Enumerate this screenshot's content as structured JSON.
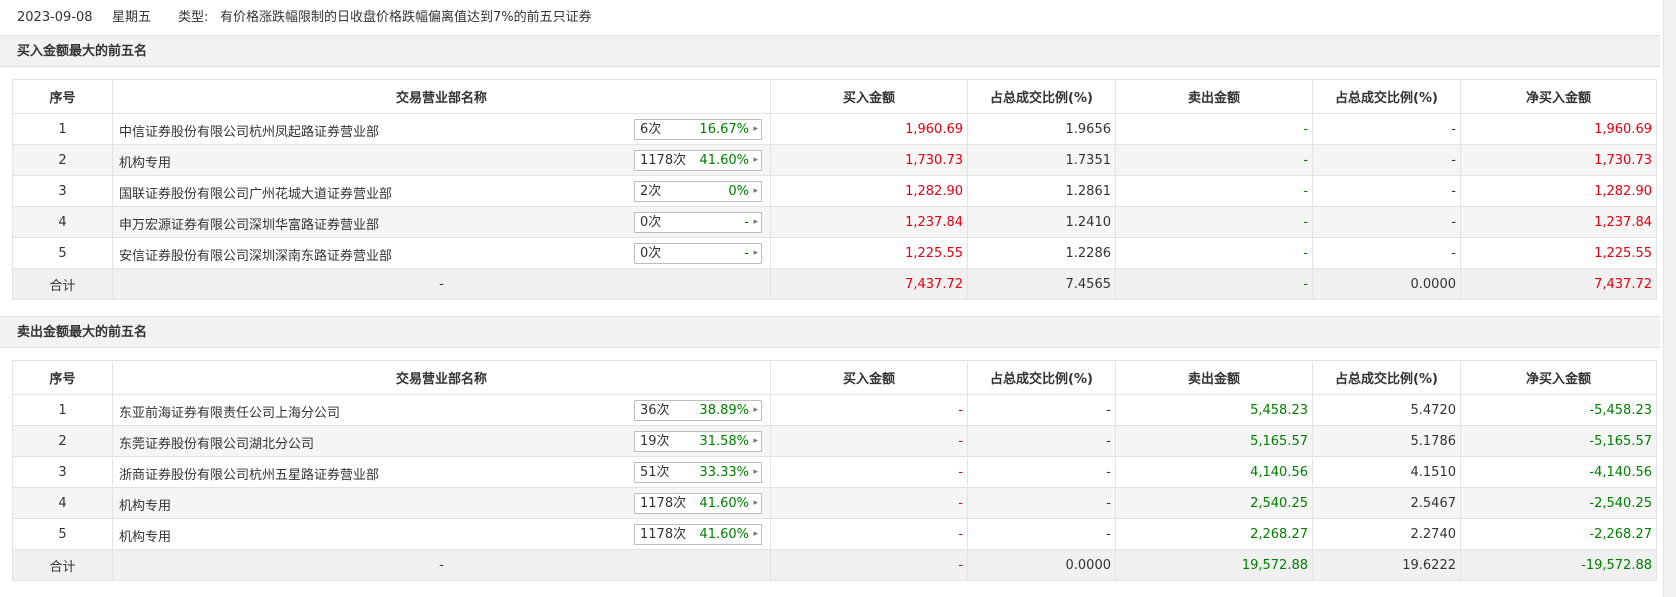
{
  "header": {
    "date": "2023-09-08",
    "weekday": "星期五",
    "type_label": "类型:",
    "type_value": "有价格涨跌幅限制的日收盘价格跌幅偏离值达到7%的前五只证券"
  },
  "columns": [
    "序号",
    "交易营业部名称",
    "买入金额",
    "占总成交比例(%)",
    "卖出金额",
    "占总成交比例(%)",
    "净买入金额"
  ],
  "buy_section": {
    "title": "买入金额最大的前五名",
    "rows": [
      {
        "idx": "1",
        "name": "中信证券股份有限公司杭州凤起路证券营业部",
        "count": "6次",
        "pct": "16.67%",
        "buy": "1,960.69",
        "buy_ratio": "1.9656",
        "sell": "-",
        "sell_ratio": "-",
        "net": "1,960.69"
      },
      {
        "idx": "2",
        "name": "机构专用",
        "count": "1178次",
        "pct": "41.60%",
        "buy": "1,730.73",
        "buy_ratio": "1.7351",
        "sell": "-",
        "sell_ratio": "-",
        "net": "1,730.73"
      },
      {
        "idx": "3",
        "name": "国联证券股份有限公司广州花城大道证券营业部",
        "count": "2次",
        "pct": "0%",
        "buy": "1,282.90",
        "buy_ratio": "1.2861",
        "sell": "-",
        "sell_ratio": "-",
        "net": "1,282.90"
      },
      {
        "idx": "4",
        "name": "申万宏源证券有限公司深圳华富路证券营业部",
        "count": "0次",
        "pct": "-",
        "buy": "1,237.84",
        "buy_ratio": "1.2410",
        "sell": "-",
        "sell_ratio": "-",
        "net": "1,237.84"
      },
      {
        "idx": "5",
        "name": "安信证券股份有限公司深圳深南东路证券营业部",
        "count": "0次",
        "pct": "-",
        "buy": "1,225.55",
        "buy_ratio": "1.2286",
        "sell": "-",
        "sell_ratio": "-",
        "net": "1,225.55"
      }
    ],
    "total": {
      "label": "合计",
      "name": "-",
      "buy": "7,437.72",
      "buy_ratio": "7.4565",
      "sell": "-",
      "sell_ratio": "0.0000",
      "net": "7,437.72"
    }
  },
  "sell_section": {
    "title": "卖出金额最大的前五名",
    "rows": [
      {
        "idx": "1",
        "name": "东亚前海证券有限责任公司上海分公司",
        "count": "36次",
        "pct": "38.89%",
        "buy": "-",
        "buy_ratio": "-",
        "sell": "5,458.23",
        "sell_ratio": "5.4720",
        "net": "-5,458.23"
      },
      {
        "idx": "2",
        "name": "东莞证券股份有限公司湖北分公司",
        "count": "19次",
        "pct": "31.58%",
        "buy": "-",
        "buy_ratio": "-",
        "sell": "5,165.57",
        "sell_ratio": "5.1786",
        "net": "-5,165.57"
      },
      {
        "idx": "3",
        "name": "浙商证券股份有限公司杭州五星路证券营业部",
        "count": "51次",
        "pct": "33.33%",
        "buy": "-",
        "buy_ratio": "-",
        "sell": "4,140.56",
        "sell_ratio": "4.1510",
        "net": "-4,140.56"
      },
      {
        "idx": "4",
        "name": "机构专用",
        "count": "1178次",
        "pct": "41.60%",
        "buy": "-",
        "buy_ratio": "-",
        "sell": "2,540.25",
        "sell_ratio": "2.5467",
        "net": "-2,540.25"
      },
      {
        "idx": "5",
        "name": "机构专用",
        "count": "1178次",
        "pct": "41.60%",
        "buy": "-",
        "buy_ratio": "-",
        "sell": "2,268.27",
        "sell_ratio": "2.2740",
        "net": "-2,268.27"
      }
    ],
    "total": {
      "label": "合计",
      "name": "-",
      "buy": "-",
      "buy_ratio": "0.0000",
      "sell": "19,572.88",
      "sell_ratio": "19.6222",
      "net": "-19,572.88"
    }
  },
  "colors": {
    "up": "#e60012",
    "down": "#008000"
  }
}
